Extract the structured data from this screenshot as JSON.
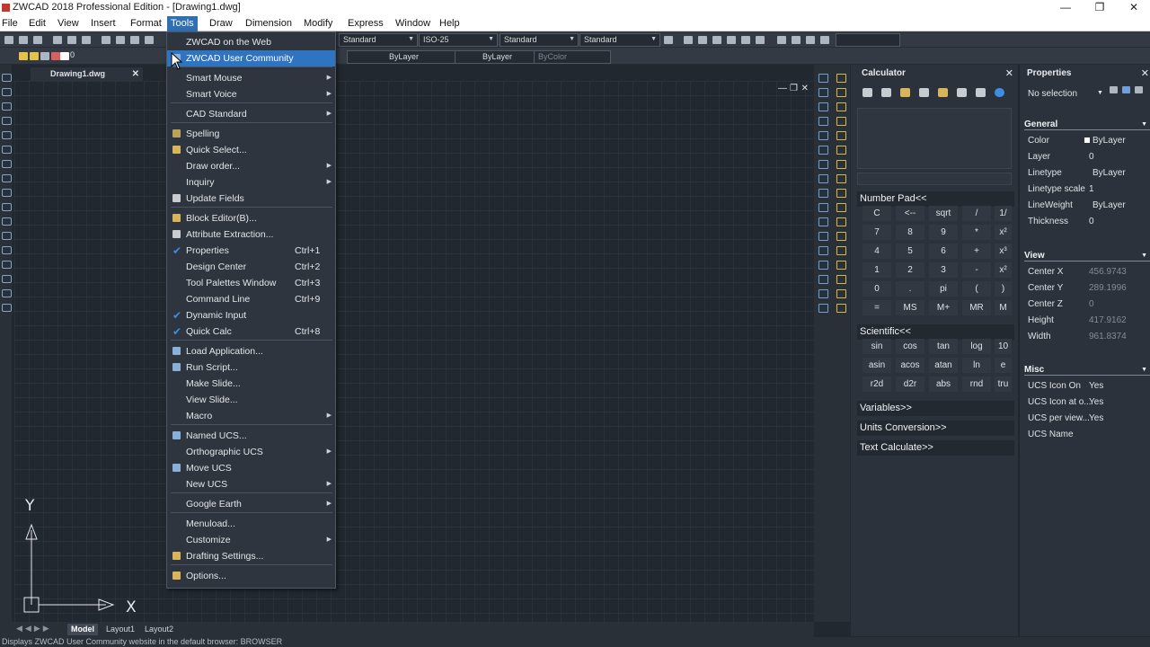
{
  "window": {
    "title": "ZWCAD 2018 Professional Edition - [Drawing1.dwg]"
  },
  "menubar": [
    "File",
    "Edit",
    "View",
    "Insert",
    "Format",
    "Tools",
    "Draw",
    "Dimension",
    "Modify",
    "Express",
    "Window",
    "Help"
  ],
  "toolbar": {
    "text_style": "Standard",
    "dim_style": "ISO-25",
    "table_style": "Standard",
    "multileader_style": "Standard",
    "layer_value": "0",
    "linetype": "ByLayer",
    "lineweight": "ByLayer",
    "plotstyle": "ByColor"
  },
  "document": {
    "tab": "Drawing1.dwg"
  },
  "tools_menu": {
    "items": [
      {
        "label": "ZWCAD on the Web"
      },
      {
        "label": "ZWCAD User Community",
        "highlight": true
      },
      {
        "label": "Smart Mouse",
        "submenu": true
      },
      {
        "label": "Smart Voice",
        "submenu": true
      },
      {
        "label": "CAD Standard",
        "submenu": true
      },
      {
        "label": "Spelling"
      },
      {
        "label": "Quick Select..."
      },
      {
        "label": "Draw order...",
        "submenu": true
      },
      {
        "label": "Inquiry",
        "submenu": true
      },
      {
        "label": "Update Fields"
      },
      {
        "label": "Block Editor(B)..."
      },
      {
        "label": "Attribute Extraction..."
      },
      {
        "label": "Properties",
        "shortcut": "Ctrl+1",
        "checked": true
      },
      {
        "label": "Design Center",
        "shortcut": "Ctrl+2"
      },
      {
        "label": "Tool Palettes Window",
        "shortcut": "Ctrl+3"
      },
      {
        "label": "Command Line",
        "shortcut": "Ctrl+9"
      },
      {
        "label": "Dynamic Input",
        "checked": true
      },
      {
        "label": "Quick Calc",
        "shortcut": "Ctrl+8",
        "checked": true
      },
      {
        "label": "Load Application..."
      },
      {
        "label": "Run Script..."
      },
      {
        "label": "Make Slide..."
      },
      {
        "label": "View Slide..."
      },
      {
        "label": "Macro",
        "submenu": true
      },
      {
        "label": "Named UCS..."
      },
      {
        "label": "Orthographic UCS",
        "submenu": true
      },
      {
        "label": "Move UCS"
      },
      {
        "label": "New UCS",
        "submenu": true
      },
      {
        "label": "Google Earth",
        "submenu": true
      },
      {
        "label": "Menuload..."
      },
      {
        "label": "Customize",
        "submenu": true
      },
      {
        "label": "Drafting Settings..."
      },
      {
        "label": "Options..."
      }
    ]
  },
  "calculator": {
    "title": "Calculator",
    "numpad_header": "Number Pad<<",
    "numpad_keys": [
      [
        "C",
        "<--",
        "sqrt",
        "/",
        "1/"
      ],
      [
        "7",
        "8",
        "9",
        "*",
        "x²"
      ],
      [
        "4",
        "5",
        "6",
        "+",
        "x³"
      ],
      [
        "1",
        "2",
        "3",
        "-",
        "x²"
      ],
      [
        "0",
        ".",
        "pi",
        "(",
        ")"
      ],
      [
        "=",
        "MS",
        "M+",
        "MR",
        "M"
      ]
    ],
    "scientific_header": "Scientific<<",
    "sci_keys": [
      [
        "sin",
        "cos",
        "tan",
        "log",
        "10"
      ],
      [
        "asin",
        "acos",
        "atan",
        "ln",
        "e"
      ],
      [
        "r2d",
        "d2r",
        "abs",
        "rnd",
        "tru"
      ]
    ],
    "variables_header": "Variables>>",
    "units_header": "Units Conversion>>",
    "text_calc_header": "Text Calculate>>"
  },
  "properties": {
    "title": "Properties",
    "selection": "No selection",
    "groups": [
      {
        "name": "General",
        "rows": [
          {
            "k": "Color",
            "v": "ByLayer"
          },
          {
            "k": "Layer",
            "v": "0"
          },
          {
            "k": "Linetype",
            "v": "ByLayer"
          },
          {
            "k": "Linetype scale",
            "v": "1"
          },
          {
            "k": "LineWeight",
            "v": "ByLayer"
          },
          {
            "k": "Thickness",
            "v": "0"
          }
        ]
      },
      {
        "name": "View",
        "rows": [
          {
            "k": "Center X",
            "v": "456.9743"
          },
          {
            "k": "Center Y",
            "v": "289.1996"
          },
          {
            "k": "Center Z",
            "v": "0"
          },
          {
            "k": "Height",
            "v": "417.9162"
          },
          {
            "k": "Width",
            "v": "961.8374"
          }
        ]
      },
      {
        "name": "Misc",
        "rows": [
          {
            "k": "UCS Icon On",
            "v": "Yes"
          },
          {
            "k": "UCS Icon at o...",
            "v": "Yes"
          },
          {
            "k": "UCS per view...",
            "v": "Yes"
          },
          {
            "k": "UCS Name",
            "v": ""
          }
        ]
      }
    ]
  },
  "layout_tabs": [
    "Model",
    "Layout1",
    "Layout2"
  ],
  "ucs_labels": {
    "y": "Y",
    "x": "X"
  },
  "status": "Displays ZWCAD User Community website in the default browser: BROWSER"
}
